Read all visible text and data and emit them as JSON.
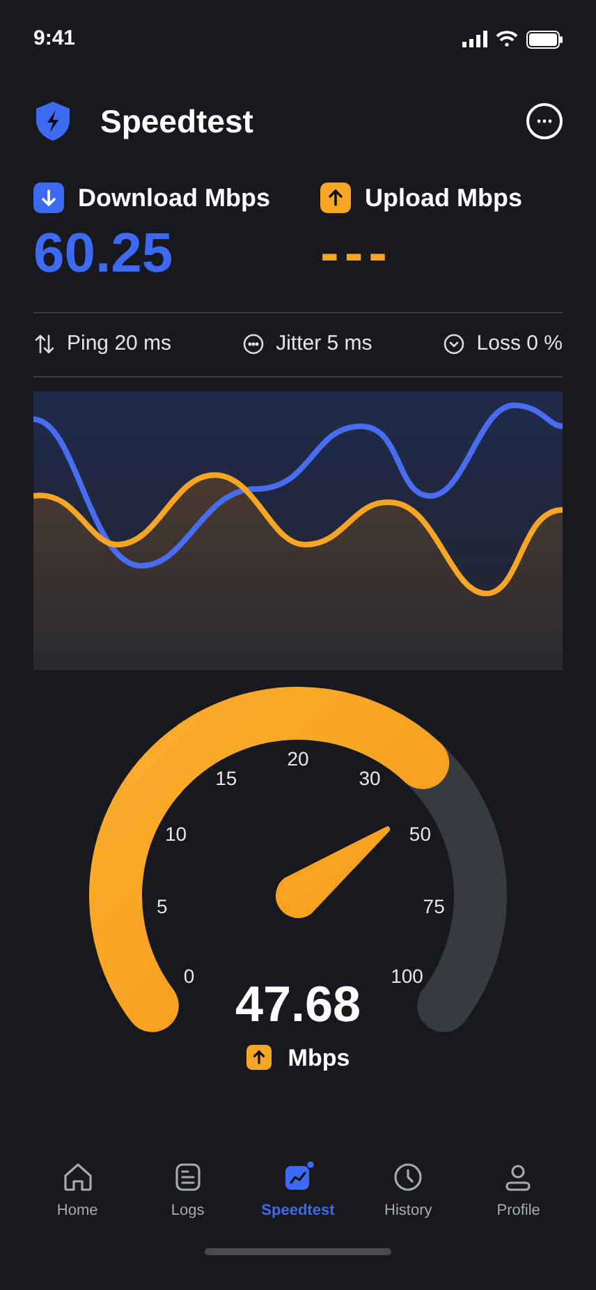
{
  "status_bar": {
    "time": "9:41"
  },
  "header": {
    "title": "Speedtest"
  },
  "results": [
    {
      "kind": "download",
      "label": "Download Mbps",
      "value": "60.25"
    },
    {
      "kind": "upload",
      "label": "Upload Mbps",
      "value": "---"
    }
  ],
  "stats": [
    {
      "kind": "ping",
      "label": "Ping 20 ms"
    },
    {
      "kind": "jitter",
      "label": "Jitter 5 ms"
    },
    {
      "kind": "loss",
      "label": "Loss 0 %"
    }
  ],
  "gauge": {
    "ticks": [
      "0",
      "5",
      "10",
      "15",
      "20",
      "30",
      "50",
      "75",
      "100"
    ],
    "reading": "47.68",
    "unit": "Mbps"
  },
  "nav": [
    {
      "kind": "home",
      "label": "Home",
      "selected": false
    },
    {
      "kind": "logs",
      "label": "Logs",
      "selected": false
    },
    {
      "kind": "speedtest",
      "label": "Speedtest",
      "selected": true
    },
    {
      "kind": "history",
      "label": "History",
      "selected": false
    },
    {
      "kind": "profile",
      "label": "Profile",
      "selected": false
    }
  ]
}
